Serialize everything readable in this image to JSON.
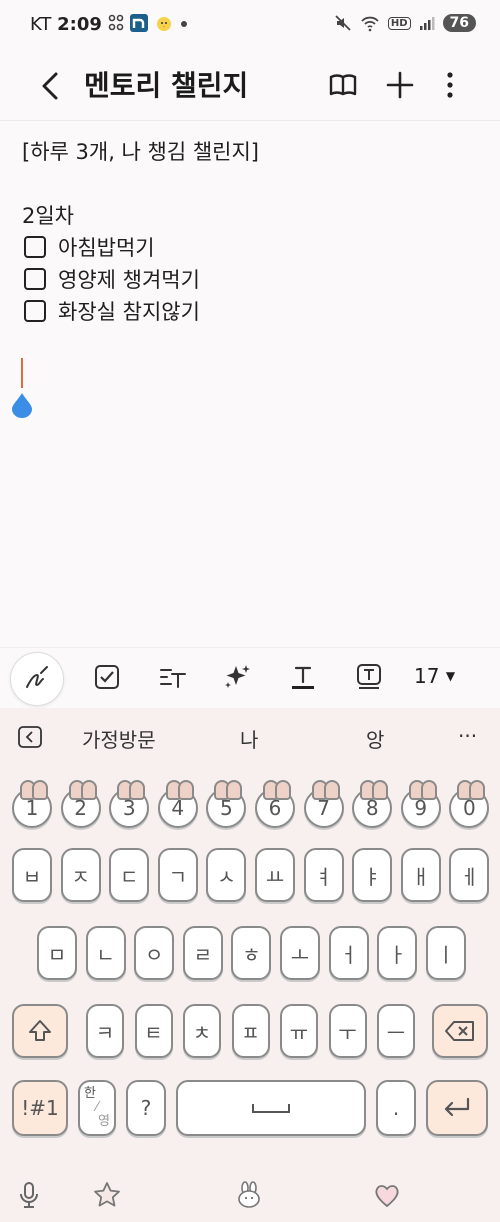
{
  "status_bar": {
    "carrier": "KT",
    "time": "2:09",
    "net": "HD",
    "battery": "76"
  },
  "header": {
    "title": "멘토리 챌린지",
    "font_size": "17"
  },
  "note": {
    "heading": "[하루 3개, 나 챙김 챌린지]",
    "day": "2일차",
    "items": [
      "아침밥먹기",
      "영양제 챙겨먹기",
      "화장실 참지않기"
    ]
  },
  "keyboard": {
    "suggestions": [
      "가정방문",
      "나",
      "앙"
    ],
    "more": "···",
    "numbers": [
      "1",
      "2",
      "3",
      "4",
      "5",
      "6",
      "7",
      "8",
      "9",
      "0"
    ],
    "row1": [
      "ㅂ",
      "ㅈ",
      "ㄷ",
      "ㄱ",
      "ㅅ",
      "ㅛ",
      "ㅕ",
      "ㅑ",
      "ㅐ",
      "ㅔ"
    ],
    "row2": [
      "ㅁ",
      "ㄴ",
      "ㅇ",
      "ㄹ",
      "ㅎ",
      "ㅗ",
      "ㅓ",
      "ㅏ",
      "ㅣ"
    ],
    "row3": [
      "ㅋ",
      "ㅌ",
      "ㅊ",
      "ㅍ",
      "ㅠ",
      "ㅜ",
      "ㅡ"
    ],
    "symbols_key": "!#1",
    "lang_key_top": "한",
    "lang_key_bottom": "영",
    "question_key": "?",
    "period_key": "."
  },
  "accent_colors": {
    "cursor": "#e06a3a",
    "handle": "#3b8de6",
    "special_key": "#fde8dc"
  }
}
